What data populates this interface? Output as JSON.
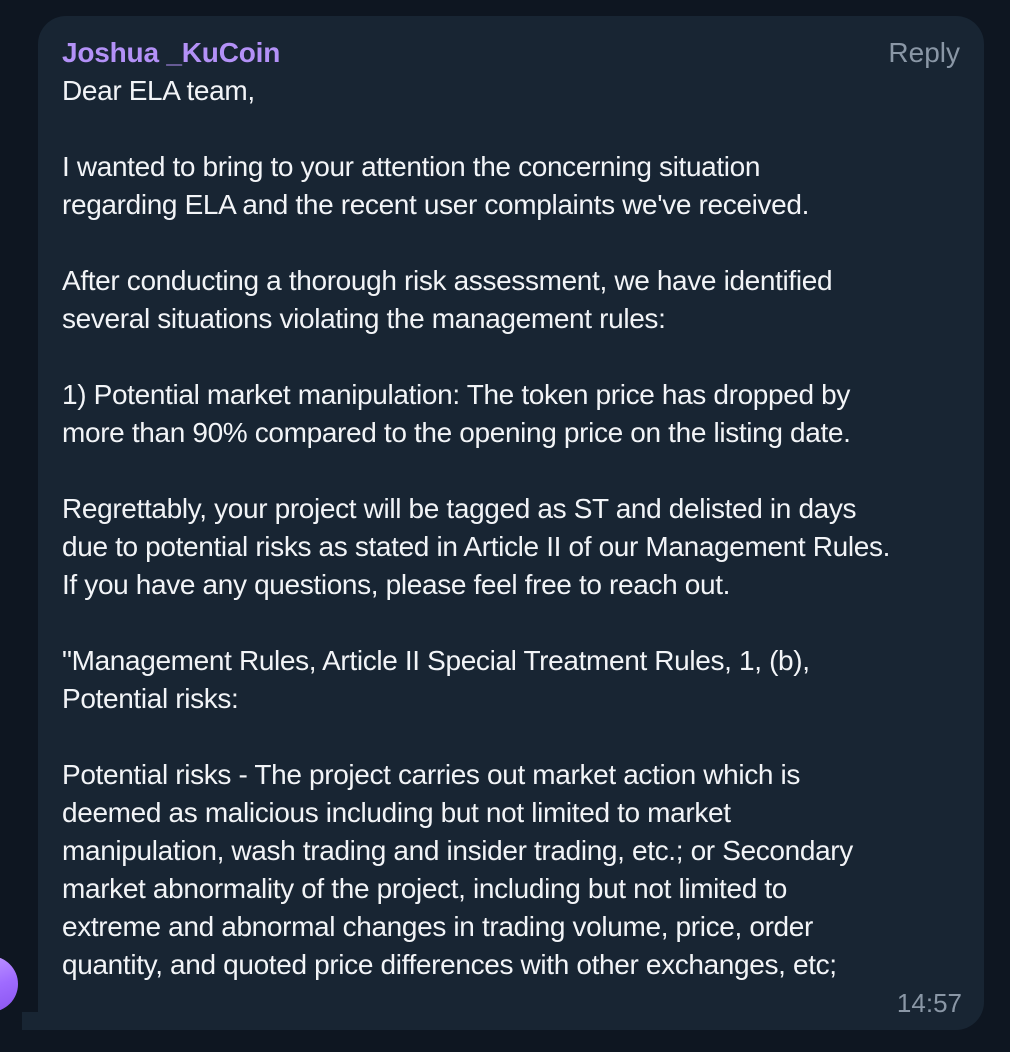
{
  "message": {
    "sender": "Joshua _KuCoin",
    "reply_label": "Reply",
    "time": "14:57",
    "paragraphs": [
      "Dear ELA team,",
      "I wanted to bring to your attention the concerning situation\nregarding ELA and the recent user complaints we've received.",
      "After conducting a thorough risk assessment, we have identified\nseveral situations violating the management rules:",
      "1) Potential market manipulation: The token price has dropped by\nmore than 90% compared to the opening price on the listing date.",
      "Regrettably, your project will be tagged as ST and delisted in days\ndue to potential risks as stated in Article II of our Management Rules.\nIf you have any questions, please feel free to reach out.",
      "\"Management Rules, Article II Special Treatment Rules, 1, (b),\nPotential risks:",
      "Potential risks - The project carries out market action which is\ndeemed as malicious including but not limited to market\nmanipulation, wash trading and insider trading, etc.; or Secondary\nmarket abnormality of the project, including but not limited to\nextreme and abnormal changes in trading volume, price, order\nquantity, and quoted price differences with other exchanges, etc;"
    ]
  },
  "colors": {
    "background": "#0e1621",
    "bubble": "#182533",
    "sender_name": "#b391f7",
    "text": "#f2f4f7",
    "meta": "#8a97a6",
    "avatar": "#a97cff"
  }
}
